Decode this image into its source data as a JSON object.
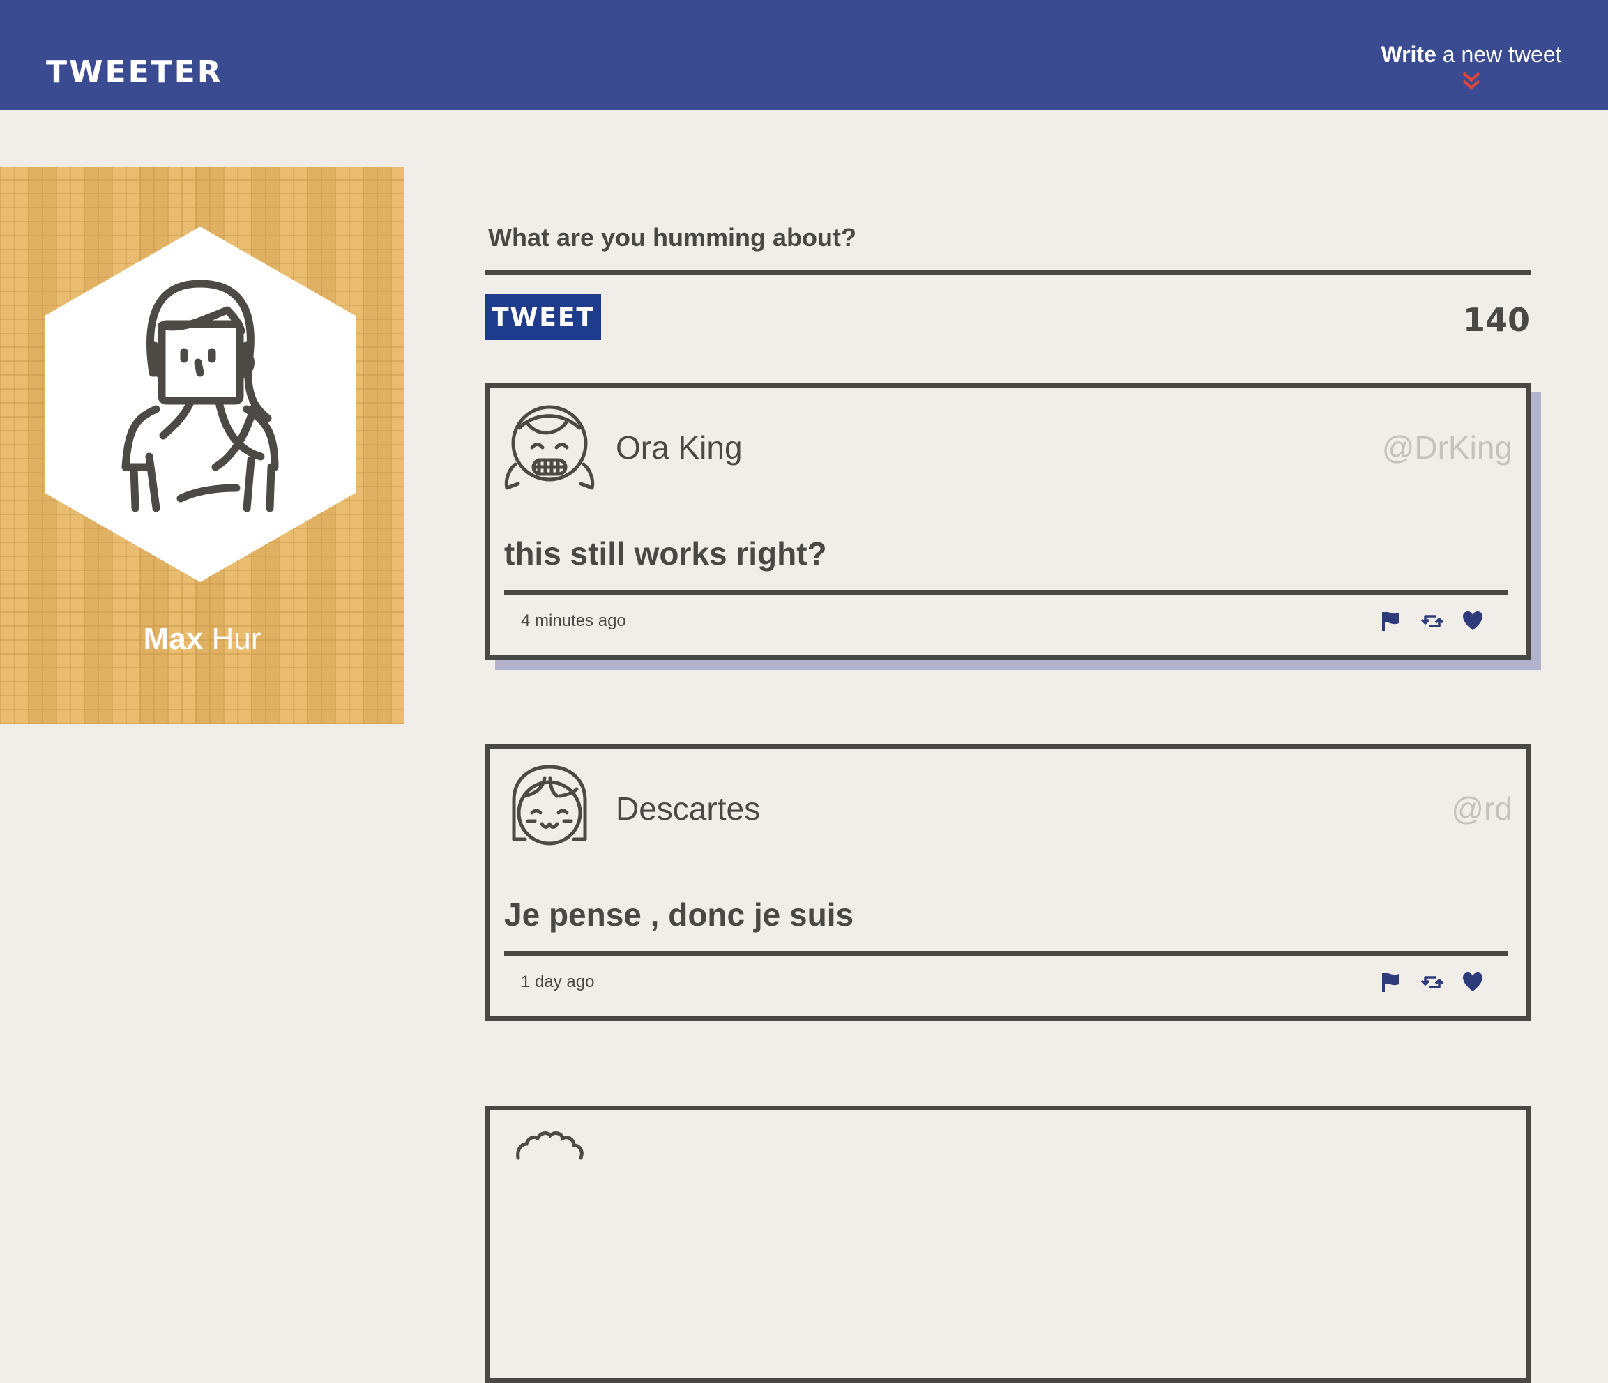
{
  "nav": {
    "logo": "TWEETER",
    "compose_toggle": {
      "strong": "Write",
      "rest": " a new tweet"
    }
  },
  "profile": {
    "first_name": "Max",
    "last_name": " Hur",
    "avatar_icon": "user-avatar-icon"
  },
  "compose": {
    "label": "What are you humming about?",
    "input_value": "",
    "button_label": "TWEET",
    "counter": "140"
  },
  "tweets": [
    {
      "name": "Ora King",
      "handle": "@DrKing",
      "text": "this still works right?",
      "time": "4 minutes ago",
      "avatar_icon": "smiling-girl-avatar-icon"
    },
    {
      "name": "Descartes",
      "handle": "@rd",
      "text": "Je pense , donc je suis",
      "time": "1 day ago",
      "avatar_icon": "happy-bob-hair-avatar-icon"
    },
    {
      "name": "",
      "handle": "",
      "text": "",
      "time": "",
      "avatar_icon": "curly-hair-avatar-icon"
    }
  ],
  "actions": [
    "flag-icon",
    "retweet-icon",
    "heart-icon"
  ],
  "colors": {
    "navbar": "#3b4b92",
    "accent_red": "#e0473a",
    "button": "#1f3b8c",
    "text": "#4a4845",
    "profile_bg": "#e9b866",
    "card_shadow": "#b2b2cc"
  }
}
